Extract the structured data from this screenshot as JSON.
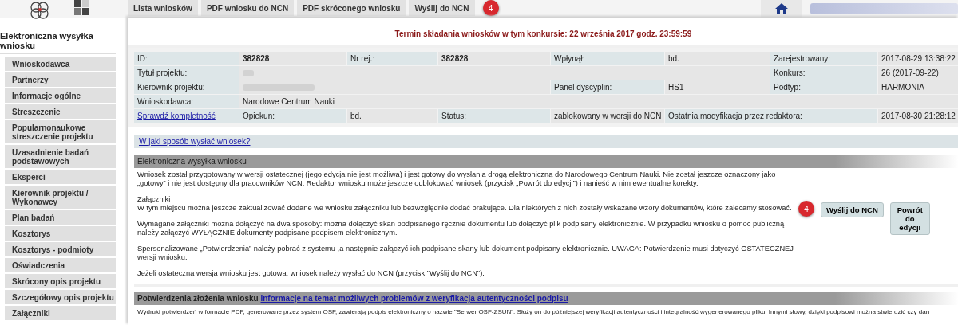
{
  "top_tabs": [
    {
      "label": "Lista wniosków"
    },
    {
      "label": "PDF wniosku do NCN"
    },
    {
      "label": "PDF skróconego wniosku"
    },
    {
      "label": "Wyślij do NCN"
    }
  ],
  "top_badge": "4",
  "sidebar": {
    "title": "Elektroniczna wysyłka wniosku",
    "items": [
      "Wnioskodawca",
      "Partnerzy",
      "Informacje ogólne",
      "Streszczenie",
      "Popularnonaukowe streszczenie projektu",
      "Uzasadnienie badań podstawowych",
      "Eksperci",
      "Kierownik projektu / Wykonawcy",
      "Plan badań",
      "Kosztorys",
      "Kosztorys - podmioty",
      "Oświadczenia",
      "Skrócony opis projektu",
      "Szczegółowy opis projektu",
      "Załączniki"
    ]
  },
  "deadline": "Termin składania wniosków w tym konkursie: 22 września 2017 godz. 23:59:59",
  "info_rows": [
    [
      {
        "kind": "label",
        "text": "ID:"
      },
      {
        "kind": "strong",
        "text": "382828"
      },
      {
        "kind": "label",
        "text": "Nr rej.:"
      },
      {
        "kind": "strong",
        "text": "382828"
      },
      {
        "kind": "label",
        "text": "Wpłynął:"
      },
      {
        "kind": "value",
        "text": "bd."
      },
      {
        "kind": "label",
        "text": "Zarejestrowany:"
      },
      {
        "kind": "value",
        "text": "2017-08-29 13:38:22"
      }
    ],
    [
      {
        "kind": "label",
        "text": "Tytuł projektu:"
      },
      {
        "kind": "redacted"
      },
      {
        "kind": "label",
        "text": "Konkurs:"
      },
      {
        "kind": "value",
        "text": "26 (2017-09-22)"
      }
    ],
    [
      {
        "kind": "label",
        "text": "Kierownik projektu:"
      },
      {
        "kind": "redacted"
      },
      {
        "kind": "label",
        "text": "Panel dyscyplin:"
      },
      {
        "kind": "value",
        "text": "HS1"
      },
      {
        "kind": "label",
        "text": "Podtyp:"
      },
      {
        "kind": "value",
        "text": "HARMONIA"
      }
    ],
    [
      {
        "kind": "label",
        "text": "Wnioskodawca:"
      },
      {
        "kind": "value",
        "text": "Narodowe Centrum Nauki"
      }
    ],
    [
      {
        "kind": "link",
        "text": "Sprawdź kompletność"
      },
      {
        "kind": "label",
        "text": "Opiekun:"
      },
      {
        "kind": "value",
        "text": "bd."
      },
      {
        "kind": "label",
        "text": "Status:"
      },
      {
        "kind": "value",
        "text": "zablokowany w wersji do NCN"
      },
      {
        "kind": "label",
        "text": "Ostatnia modyfikacja przez redaktora:"
      },
      {
        "kind": "value",
        "text": "2017-08-30 21:28:12"
      }
    ]
  ],
  "help_link": "W jaki sposób wysłać wniosek?",
  "send_section": {
    "title": "Elektroniczna wysyłka wniosku",
    "paragraphs": [
      "Wniosek został przygotowany w wersji ostatecznej (jego edycja nie jest możliwa) i jest gotowy do wysłania drogą elektroniczną do Narodowego Centrum Nauki. Nie został jeszcze oznaczony jako „gotowy” i nie jest dostępny dla pracowników NCN. Redaktor wniosku może jeszcze odblokować wniosek (przycisk „Powrót do edycji”) i nanieść w nim ewentualne korekty.",
      "Załączniki",
      "W tym miejscu można jeszcze zaktualizować dodane we wniosku załączniku lub bezwzględnie dodać brakujące. Dla niektórych z nich zostały wskazane wzory dokumentów, które zalecamy stosować.",
      "Wymagane załączniki można dołączyć na dwa sposoby: można dołączyć skan podpisanego ręcznie dokumentu lub dołączyć plik podpisany elektronicznie. W przypadku wniosku o pomoc publiczną należy załączyć WYŁĄCZNIE dokumenty podpisane podpisem elektronicznym.",
      "Spersonalizowane „Potwierdzenia” należy pobrać z systemu ,a następnie załączyć ich podpisane skany lub dokument podpisany elektronicznie. UWAGA: Potwierdzenie musi dotyczyć OSTATECZNEJ wersji wniosku.",
      "Jeżeli ostateczna wersja wniosku jest gotowa, wniosek należy wysłać do NCN (przycisk \"Wyślij do NCN\")."
    ],
    "badge": "4",
    "buttons": [
      "Wyślij do NCN",
      "Powrót do edycji"
    ]
  },
  "confirm_section": {
    "title": "Potwierdzenia złożenia wniosku",
    "link": "Informacje na temat możliwych problemów z weryfikacja autentyczności podpisu",
    "text": "Wydruki potwierdzeń w formacie PDF, generowane przez system OSF, zawierają podpis elektroniczny o nazwie \"Serwer OSF-ZSUN\". Służy on do późniejszej weryfikacji autentyczności i integralność wygenerowanego pliku. Innymi słowy, dzięki podpisowi można stwierdzić czy dan"
  }
}
